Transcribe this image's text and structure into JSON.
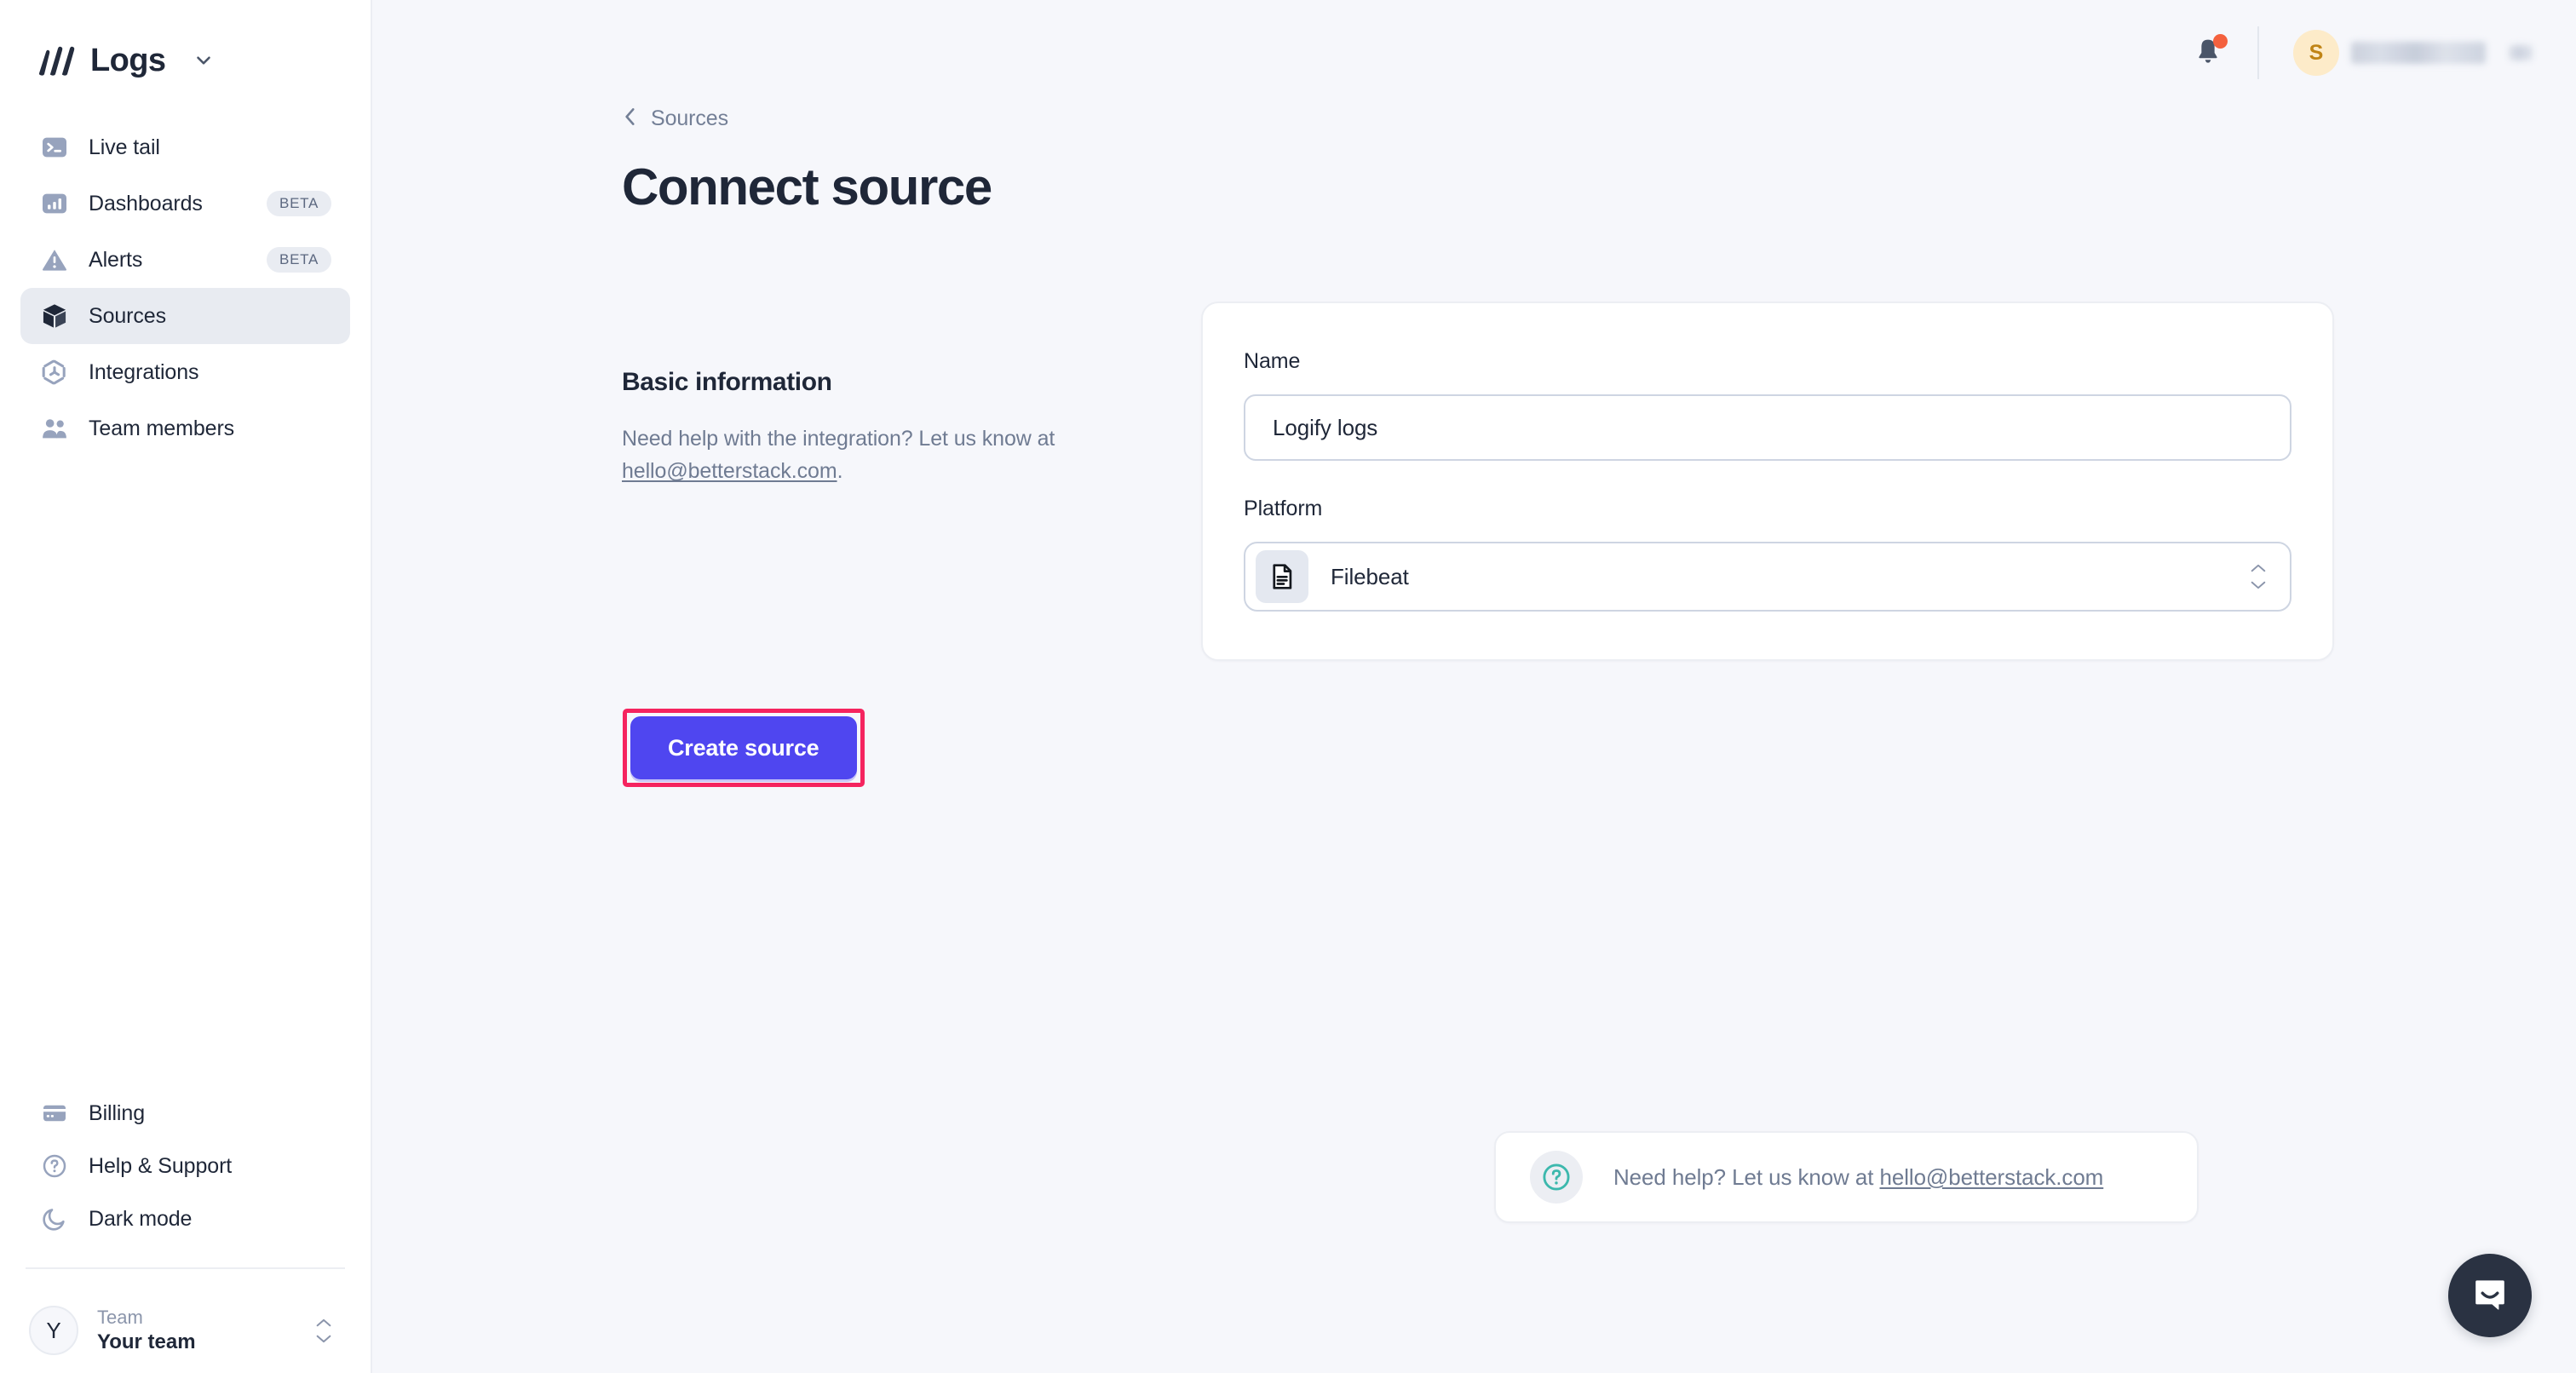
{
  "sidebar": {
    "brand": {
      "name": "Logs",
      "logo_icon": "betterstack-logo-icon",
      "caret_icon": "chevron-down-icon"
    },
    "items": [
      {
        "label": "Live tail",
        "icon": "terminal-icon",
        "badge": "",
        "active": false
      },
      {
        "label": "Dashboards",
        "icon": "bar-chart-icon",
        "badge": "BETA",
        "active": false
      },
      {
        "label": "Alerts",
        "icon": "alert-triangle-icon",
        "badge": "BETA",
        "active": false
      },
      {
        "label": "Sources",
        "icon": "cube-icon",
        "badge": "",
        "active": true
      },
      {
        "label": "Integrations",
        "icon": "integrations-icon",
        "badge": "",
        "active": false
      },
      {
        "label": "Team members",
        "icon": "users-icon",
        "badge": "",
        "active": false
      }
    ],
    "bottom_items": [
      {
        "label": "Billing",
        "icon": "credit-card-icon"
      },
      {
        "label": "Help & Support",
        "icon": "question-circle-icon"
      },
      {
        "label": "Dark mode",
        "icon": "moon-icon"
      }
    ],
    "team": {
      "avatar_initial": "Y",
      "kicker": "Team",
      "name": "Your team",
      "caret_icon": "chevron-up-down-icon"
    }
  },
  "topbar": {
    "notifications_icon": "bell-icon",
    "has_unread": true,
    "user_avatar_initial": "S",
    "user_name_redacted": true
  },
  "main": {
    "breadcrumb": {
      "label": "Sources",
      "icon": "chevron-left-icon"
    },
    "title": "Connect source",
    "left": {
      "section_title": "Basic information",
      "description_prefix": "Need help with the integration? Let us know at ",
      "description_link": "hello@betterstack.com",
      "description_suffix": "."
    },
    "form": {
      "name_label": "Name",
      "name_value": "Logify logs",
      "name_placeholder": "Source name",
      "platform_label": "Platform",
      "platform_value": "Filebeat",
      "platform_icon": "file-document-icon",
      "platform_caret_icon": "chevron-up-down-icon"
    },
    "cta": {
      "label": "Create source",
      "color": "#4f46f0",
      "highlight_color": "#f5245f",
      "highlighted": true
    },
    "help_footer": {
      "icon": "question-circle-icon",
      "text_prefix": "Need help? Let us know at ",
      "link": "hello@betterstack.com"
    }
  },
  "widgets": {
    "intercom": {
      "icon": "intercom-chat-icon",
      "label": "Open chat"
    }
  },
  "colors": {
    "page_background": "#f6f7fb",
    "sidebar_background": "#ffffff",
    "accent": "#4f46f0",
    "annotation": "#f5245f",
    "text_primary": "#1f2738",
    "text_muted": "#6f7b92",
    "icon_muted": "#9aa5bd",
    "notification_dot": "#f4613e",
    "help_icon": "#3cb8ad"
  }
}
